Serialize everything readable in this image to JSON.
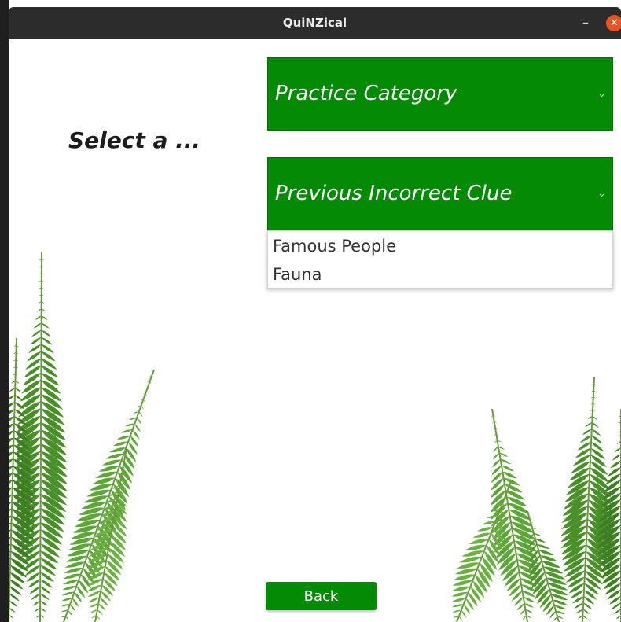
{
  "window": {
    "title": "QuiNZical",
    "minimize_glyph": "–",
    "close_glyph": "✕"
  },
  "main": {
    "heading": "Select a ...",
    "combos": [
      {
        "label": "Practice Category",
        "chevron": "⌄"
      },
      {
        "label": "Previous Incorrect Clue",
        "chevron": "⌄"
      }
    ],
    "dropdown_options": [
      "Famous People",
      "Fauna"
    ],
    "back_label": "Back"
  },
  "colors": {
    "accent_green": "#058a05",
    "titlebar": "#2c2c2c",
    "close_button": "#e9541f",
    "fern_green": "#4a8f2a"
  },
  "icons": {
    "minimize": "minimize-icon",
    "close": "close-icon",
    "chevron": "chevron-down-icon",
    "background_art": "fern-decoration"
  }
}
